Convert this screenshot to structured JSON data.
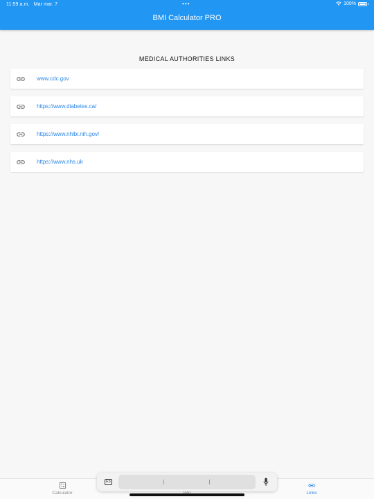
{
  "status_bar": {
    "time": "11:59 a.m.",
    "date": "Mar mar. 7",
    "dots": "•••",
    "battery": "100%"
  },
  "header": {
    "title": "BMI Calculator PRO"
  },
  "section": {
    "title": "MEDICAL AUTHORITIES LINKS"
  },
  "links": [
    {
      "label": "www.cdc.gov",
      "icon": "link-icon"
    },
    {
      "label": "https://www.diabetes.ca/",
      "icon": "link-icon"
    },
    {
      "label": "https://www.nhlbi.nih.gov/",
      "icon": "link-icon"
    },
    {
      "label": "https://www.nhs.uk",
      "icon": "link-icon"
    }
  ],
  "tabs": [
    {
      "label": "Calculator",
      "icon": "calculator-icon",
      "active": false
    },
    {
      "label": "Info",
      "icon": "info-icon",
      "active": false
    },
    {
      "label": "Links",
      "icon": "link-icon",
      "active": true
    }
  ],
  "keyboard_bar": {
    "language": "ES"
  },
  "colors": {
    "primary": "#2196f3",
    "link": "#2a86e8",
    "background": "#f7f7f7"
  }
}
